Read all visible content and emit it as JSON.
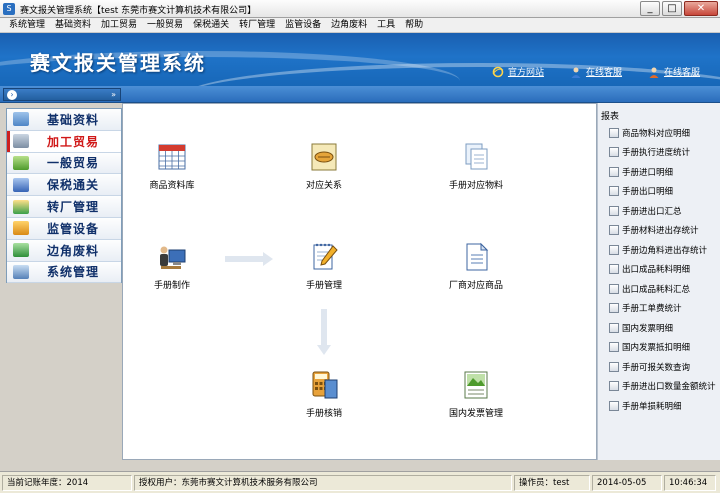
{
  "window": {
    "title": "赛文报关管理系统【test 东莞市赛文计算机技术有限公司】",
    "min": "_",
    "max": "□",
    "close": "✕"
  },
  "menu": [
    "系统管理",
    "基础资料",
    "加工贸易",
    "一般贸易",
    "保税通关",
    "转厂管理",
    "监管设备",
    "边角废料",
    "工具",
    "帮助"
  ],
  "banner": {
    "brand": "赛文报关管理系统",
    "links": [
      "官方网站",
      "在线客服",
      "在线客服"
    ]
  },
  "nav": {
    "items": [
      "基础资料",
      "加工贸易",
      "一般贸易",
      "保税通关",
      "转厂管理",
      "监管设备",
      "边角废料",
      "系统管理"
    ],
    "active_index": 1
  },
  "tiles": {
    "product_library": "商品资料库",
    "correspondence": "对应关系",
    "manual_materials": "手册对应物料",
    "manual_making": "手册制作",
    "manual_manage": "手册管理",
    "vendor_goods": "厂商对应商品",
    "manual_verify": "手册核销",
    "invoice_manage": "国内发票管理"
  },
  "report": {
    "title": "报表",
    "items": [
      "商品物料对应明细",
      "手册执行进度统计",
      "手册进口明细",
      "手册出口明细",
      "手册进出口汇总",
      "手册材料进出存统计",
      "手册边角料进出存统计",
      "出口成品耗料明细",
      "出口成品耗料汇总",
      "手册工单费统计",
      "国内发票明细",
      "国内发票抵扣明细",
      "手册可报关数查询",
      "手册进出口数量金额统计",
      "手册单损耗明细"
    ]
  },
  "status": {
    "year": "当前记账年度：2014",
    "user": "授权用户：东莞市赛文计算机技术服务有限公司",
    "operator": "操作员：test",
    "date": "2014-05-05",
    "time": "10:46:34"
  },
  "colors": {
    "accent": "#1f73c8",
    "active": "#d01818"
  }
}
